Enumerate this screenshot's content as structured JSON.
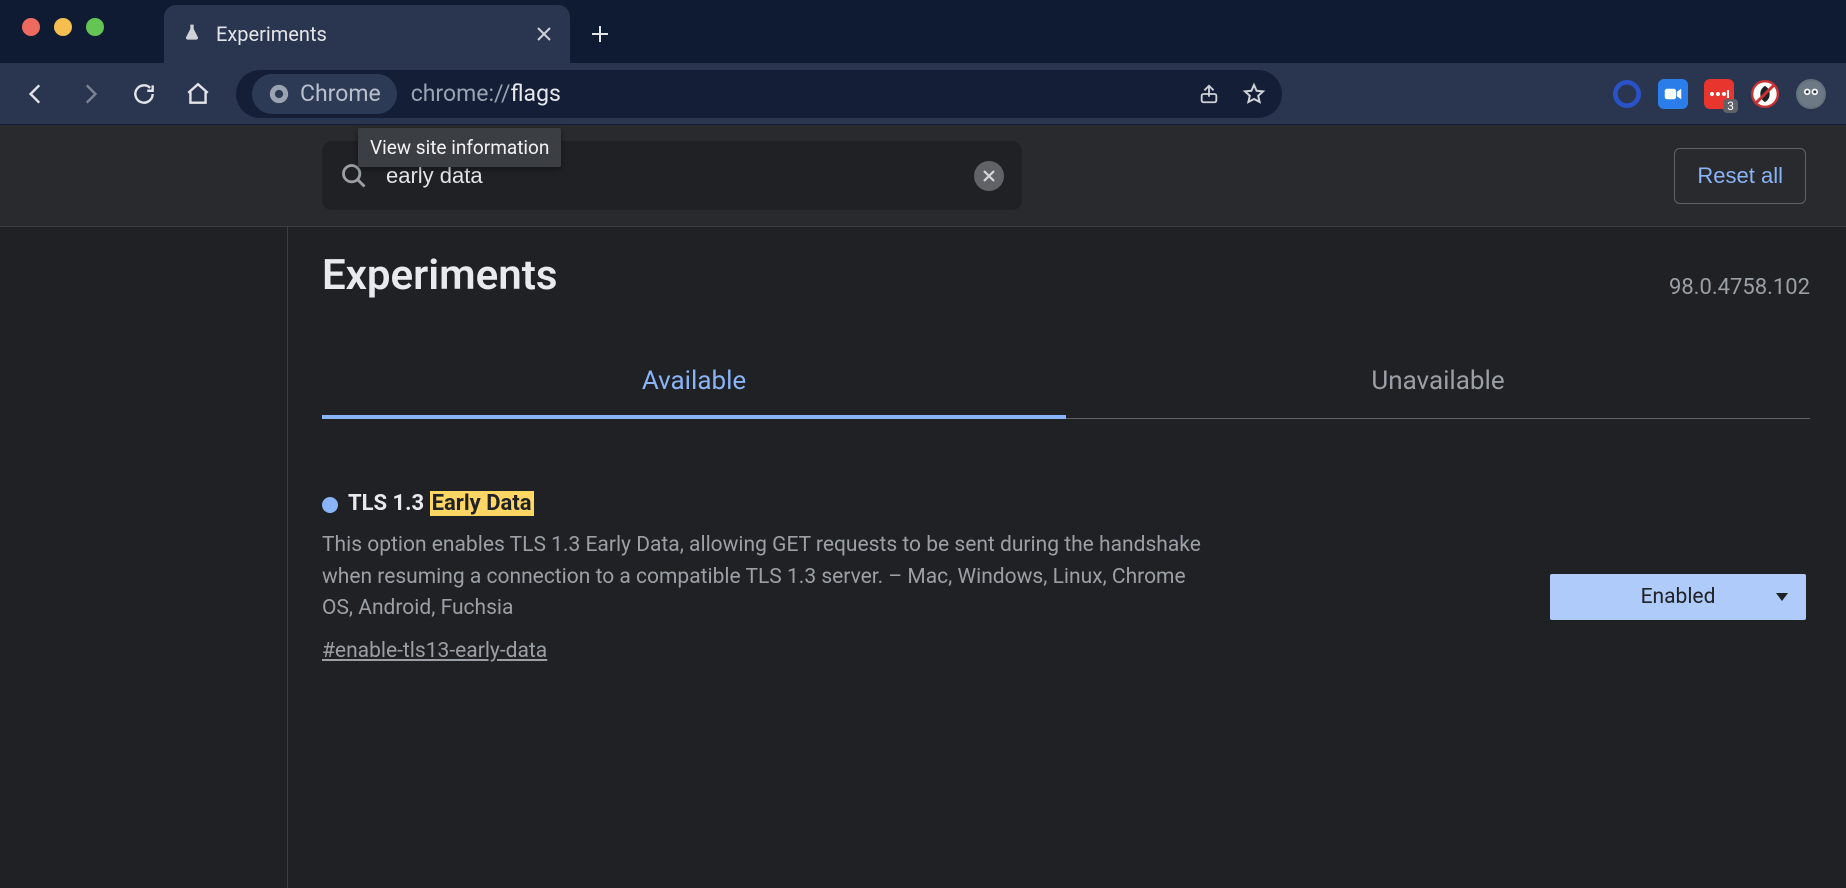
{
  "window": {
    "tab_title": "Experiments",
    "tooltip": "View site information"
  },
  "omnibox": {
    "chip_label": "Chrome",
    "url_scheme": "chrome://",
    "url_path": "flags"
  },
  "extensions": {
    "badge_count": "3"
  },
  "search": {
    "value": "early data",
    "reset_label": "Reset all"
  },
  "header": {
    "title": "Experiments",
    "version": "98.0.4758.102"
  },
  "tabs": {
    "available": "Available",
    "unavailable": "Unavailable"
  },
  "flag": {
    "title_prefix": "TLS 1.3 ",
    "title_highlight": "Early Data",
    "description": "This option enables TLS 1.3 Early Data, allowing GET requests to be sent during the handshake when resuming a connection to a compatible TLS 1.3 server. – Mac, Windows, Linux, Chrome OS, Android, Fuchsia",
    "hash": "#enable-tls13-early-data",
    "select_value": "Enabled"
  }
}
